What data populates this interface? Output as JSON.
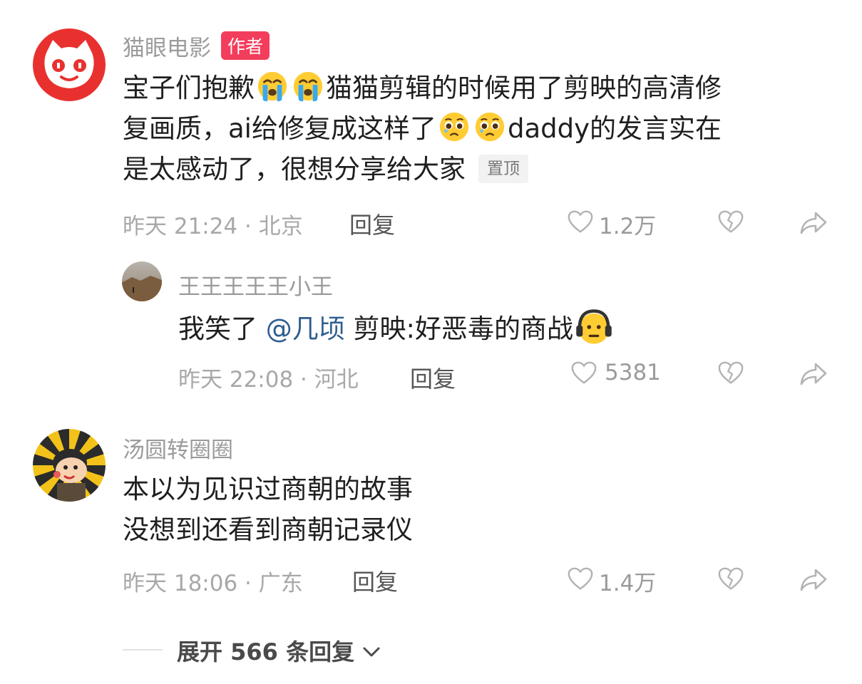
{
  "comments": [
    {
      "username": "猫眼电影",
      "author_badge": "作者",
      "text_1": "宝子们抱歉",
      "text_2": "猫猫剪辑的时候用了剪映的高清修",
      "text_3": "复画质，ai给修复成这样了",
      "text_4": "daddy的发言实在",
      "text_5": "是太感动了，很想分享给大家",
      "pin_badge": "置顶",
      "meta": "昨天 21:24 · 北京",
      "reply": "回复",
      "likes": "1.2万"
    },
    {
      "username": "王王王王王小王",
      "text_1": "我笑了 ",
      "mention": "@几顷",
      "text_2": " 剪映:好恶毒的商战",
      "meta": "昨天 22:08 · 河北",
      "reply": "回复",
      "likes": "5381"
    },
    {
      "username": "汤圆转圈圈",
      "line_1": "本以为见识过商朝的故事",
      "line_2": "没想到还看到商朝记录仪",
      "meta": "昨天 18:06 · 广东",
      "reply": "回复",
      "likes": "1.4万"
    }
  ],
  "expand_replies": "展开 566 条回复",
  "icons": {
    "like": "heart-outline-icon",
    "dislike": "broken-heart-icon",
    "share": "share-arrow-icon",
    "expand": "chevron-down-icon",
    "crying": "crying-emoji-icon",
    "pleading": "pleading-emoji-icon",
    "headphones": "headphones-emoji-icon"
  },
  "colors": {
    "author_badge": "#f33d5c",
    "mention": "#2f5e8f",
    "maoyan_red": "#e8312f"
  }
}
